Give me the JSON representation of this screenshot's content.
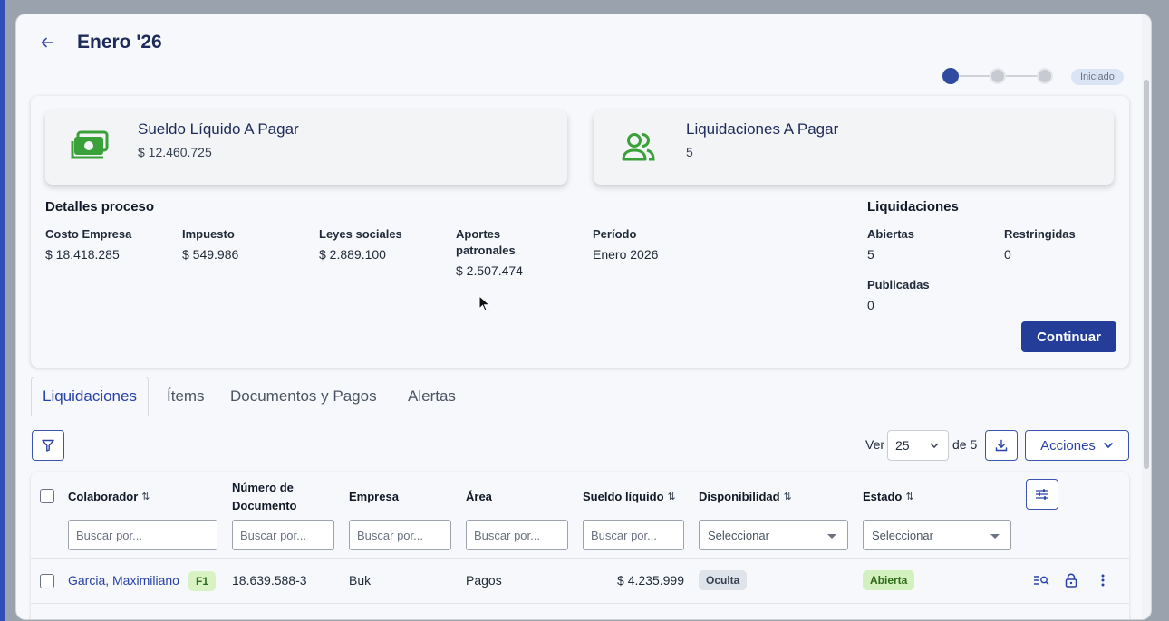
{
  "header": {
    "title": "Enero '26",
    "status": "Iniciado"
  },
  "kpis": [
    {
      "title": "Sueldo Líquido A Pagar",
      "value": "$ 12.460.725",
      "icon": "money-icon"
    },
    {
      "title": "Liquidaciones A Pagar",
      "value": "5",
      "icon": "users-icon"
    }
  ],
  "details": {
    "title": "Detalles proceso",
    "items": [
      {
        "label": "Costo Empresa",
        "value": "$ 18.418.285"
      },
      {
        "label": "Impuesto",
        "value": "$ 549.986"
      },
      {
        "label": "Leyes sociales",
        "value": "$ 2.889.100"
      },
      {
        "label": "Aportes patronales",
        "value": "$ 2.507.474"
      },
      {
        "label": "Período",
        "value": "Enero 2026"
      }
    ]
  },
  "liquidaciones_summary": {
    "title": "Liquidaciones",
    "items": [
      {
        "label": "Abiertas",
        "value": "5"
      },
      {
        "label": "Restringidas",
        "value": "0"
      },
      {
        "label": "Publicadas",
        "value": "0"
      }
    ]
  },
  "continue_label": "Continuar",
  "tabs": [
    "Liquidaciones",
    "Ítems",
    "Documentos y Pagos",
    "Alertas"
  ],
  "toolbar": {
    "ver_label": "Ver",
    "page_size": "25",
    "of_label": "de 5",
    "actions_label": "Acciones"
  },
  "table": {
    "columns": [
      {
        "label": "Colaborador",
        "filter": "Buscar por...",
        "sortable": true
      },
      {
        "label": "Número de Documento",
        "filter": "Buscar por...",
        "sortable": false
      },
      {
        "label": "Empresa",
        "filter": "Buscar por...",
        "sortable": false
      },
      {
        "label": "Área",
        "filter": "Buscar por...",
        "sortable": false
      },
      {
        "label": "Sueldo líquido",
        "filter": "Buscar por...",
        "sortable": true
      },
      {
        "label": "Disponibilidad",
        "filter": "Seleccionar",
        "sortable": true
      },
      {
        "label": "Estado",
        "filter": "Seleccionar",
        "sortable": true
      }
    ],
    "rows": [
      {
        "colaborador": "Garcia, Maximiliano",
        "tag": "F1",
        "documento": "18.639.588-3",
        "empresa": "Buk",
        "area": "Pagos",
        "sueldo": "$ 4.235.999",
        "disponibilidad": "Oculta",
        "estado": "Abierta"
      }
    ]
  },
  "colors": {
    "primary": "#233d99",
    "accent_green": "#3aa13a",
    "title": "#1e2b5a"
  }
}
